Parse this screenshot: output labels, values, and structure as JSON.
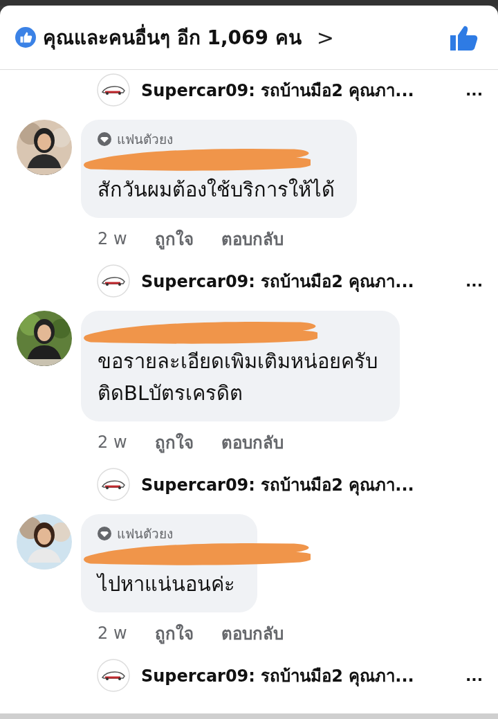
{
  "reactions": {
    "summary": "คุณและคนอื่นๆ อีก 1,069 คน",
    "chevron": ">"
  },
  "thread": [
    {
      "kind": "reply",
      "author": "Supercar09:",
      "text": "รถบ้านมือ2 คุณภา...",
      "more": "..."
    },
    {
      "kind": "comment",
      "badge": "แฟนตัวยง",
      "redacted": true,
      "avatar": {
        "kind": "picture"
      },
      "text": [
        "สักวันผมต้องใช้บริการให้ได้"
      ],
      "time": "2 w",
      "actions": [
        "ถูกใจ",
        "ตอบกลับ"
      ]
    },
    {
      "kind": "reply",
      "author": "Supercar09:",
      "text": "รถบ้านมือ2 คุณภา...",
      "more": "..."
    },
    {
      "kind": "comment",
      "redacted": true,
      "avatar": {
        "kind": "picture"
      },
      "text": [
        "ขอรายละเอียดเพิมเติมหน่อยครับ",
        "ติดBLบัตรเครดิต"
      ],
      "time": "2 w",
      "actions": [
        "ถูกใจ",
        "ตอบกลับ"
      ]
    },
    {
      "kind": "reply",
      "author": "Supercar09:",
      "text": "รถบ้านมือ2 คุณภา..."
    },
    {
      "kind": "comment",
      "badge": "แฟนตัวยง",
      "redacted": true,
      "avatar": {
        "kind": "picture"
      },
      "text": [
        "ไปหาแน่นอนค่ะ"
      ],
      "time": "2 w",
      "actions": [
        "ถูกใจ",
        "ตอบกลับ"
      ]
    },
    {
      "kind": "reply",
      "author": "Supercar09:",
      "text": "รถบ้านมือ2 คุณภา...",
      "more": "..."
    }
  ]
}
